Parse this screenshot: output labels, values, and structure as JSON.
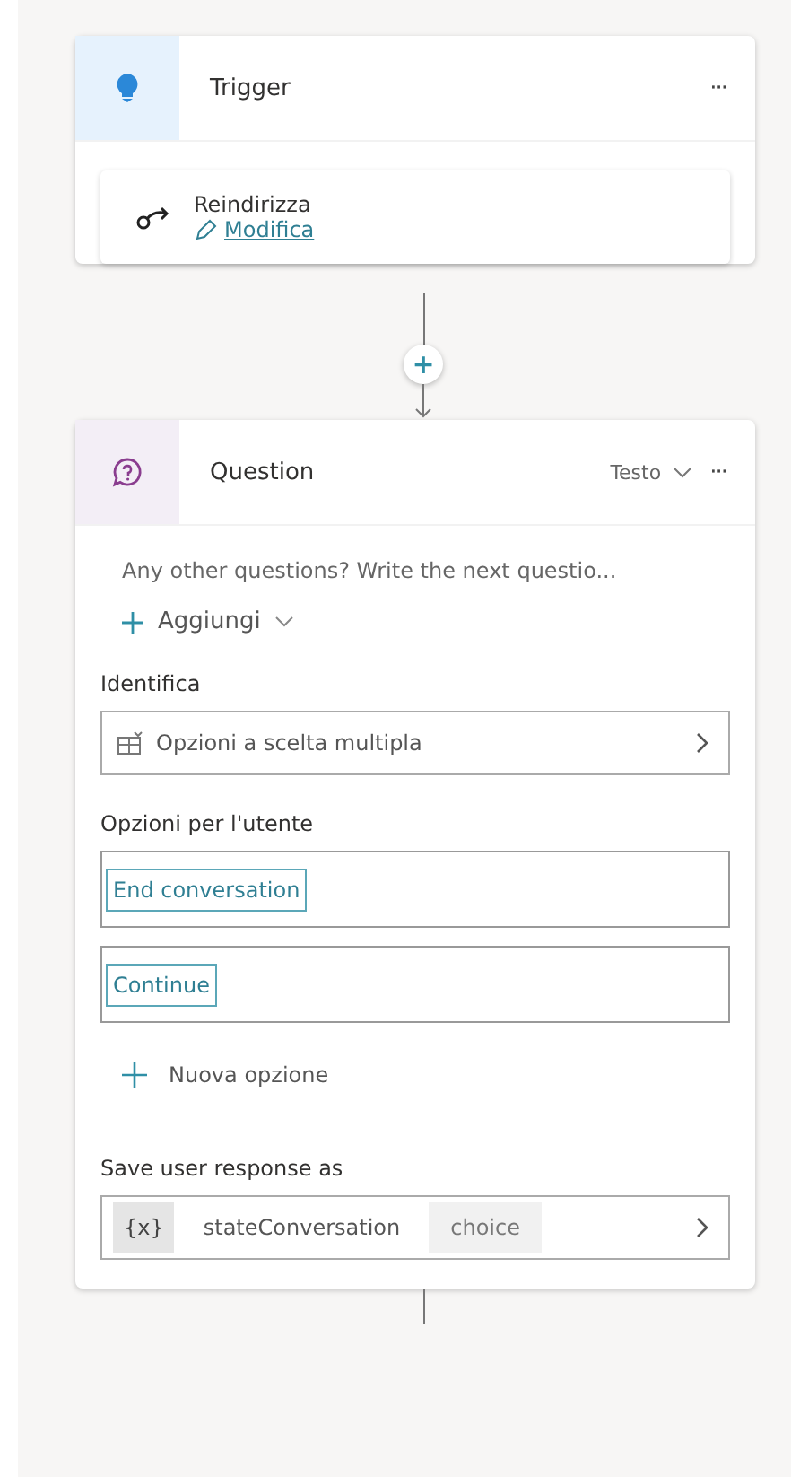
{
  "trigger": {
    "title": "Trigger",
    "more": "···",
    "action": {
      "name": "Reindirizza",
      "edit_link": "Modifica"
    }
  },
  "connector": {
    "add": "+"
  },
  "question": {
    "title": "Question",
    "format": "Testo",
    "more": "···",
    "message": {
      "placeholder": "Any other questions? Write the next questio..."
    },
    "add_button": "Aggiungi",
    "identify": {
      "label": "Identifica",
      "value": "Opzioni a scelta multipla"
    },
    "options": {
      "label": "Opzioni per l'utente",
      "items": [
        "End conversation",
        "Continue"
      ],
      "new_option": "Nuova opzione"
    },
    "save": {
      "label": "Save user response as",
      "prefix": "{x}",
      "variable": "stateConversation",
      "type": "choice"
    }
  }
}
